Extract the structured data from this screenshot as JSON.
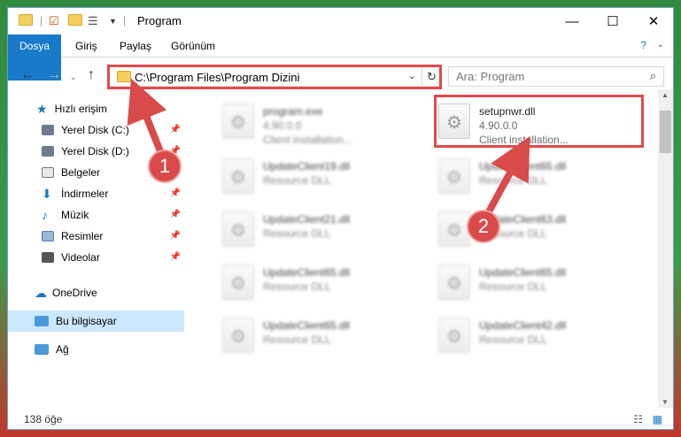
{
  "window": {
    "title": "Program"
  },
  "ribbon": {
    "tabs": [
      "Dosya",
      "Giriş",
      "Paylaş",
      "Görünüm"
    ]
  },
  "address": {
    "path": "C:\\Program Files\\Program Dizini"
  },
  "search": {
    "placeholder": "Ara: Program"
  },
  "sidebar": {
    "items": [
      {
        "label": "Hızlı erişim"
      },
      {
        "label": "Yerel Disk (C:)"
      },
      {
        "label": "Yerel Disk (D:)"
      },
      {
        "label": "Belgeler"
      },
      {
        "label": "İndirmeler"
      },
      {
        "label": "Müzik"
      },
      {
        "label": "Resimler"
      },
      {
        "label": "Videolar"
      },
      {
        "label": "OneDrive"
      },
      {
        "label": "Bu bilgisayar"
      },
      {
        "label": "Ağ"
      }
    ]
  },
  "files": [
    {
      "name": "program.exe",
      "version": "4.90.0.0",
      "desc": "Client installation..."
    },
    {
      "name": "setupnwr.dll",
      "version": "4.90.0.0",
      "desc": "Client installation..."
    },
    {
      "name": "UpdateClient19.dll",
      "desc": "Resource DLL"
    },
    {
      "name": "UpdateClient65.dll",
      "desc": "Resource DLL"
    },
    {
      "name": "UpdateClient21.dll",
      "desc": "Resource DLL"
    },
    {
      "name": "UpdateClient63.dll",
      "desc": "Resource DLL"
    },
    {
      "name": "UpdateClient65.dll",
      "desc": "Resource DLL"
    },
    {
      "name": "UpdateClient65.dll",
      "desc": "Resource DLL"
    },
    {
      "name": "UpdateClient65.dll",
      "desc": "Resource DLL"
    },
    {
      "name": "UpdateClient42.dll",
      "desc": "Resource DLL"
    }
  ],
  "annotations": {
    "badge1": "1",
    "badge2": "2"
  },
  "status": {
    "count": "138 öğe"
  },
  "colors": {
    "accent": "#1979ca",
    "highlight": "#e04a4a",
    "selected": "#cce8ff"
  }
}
